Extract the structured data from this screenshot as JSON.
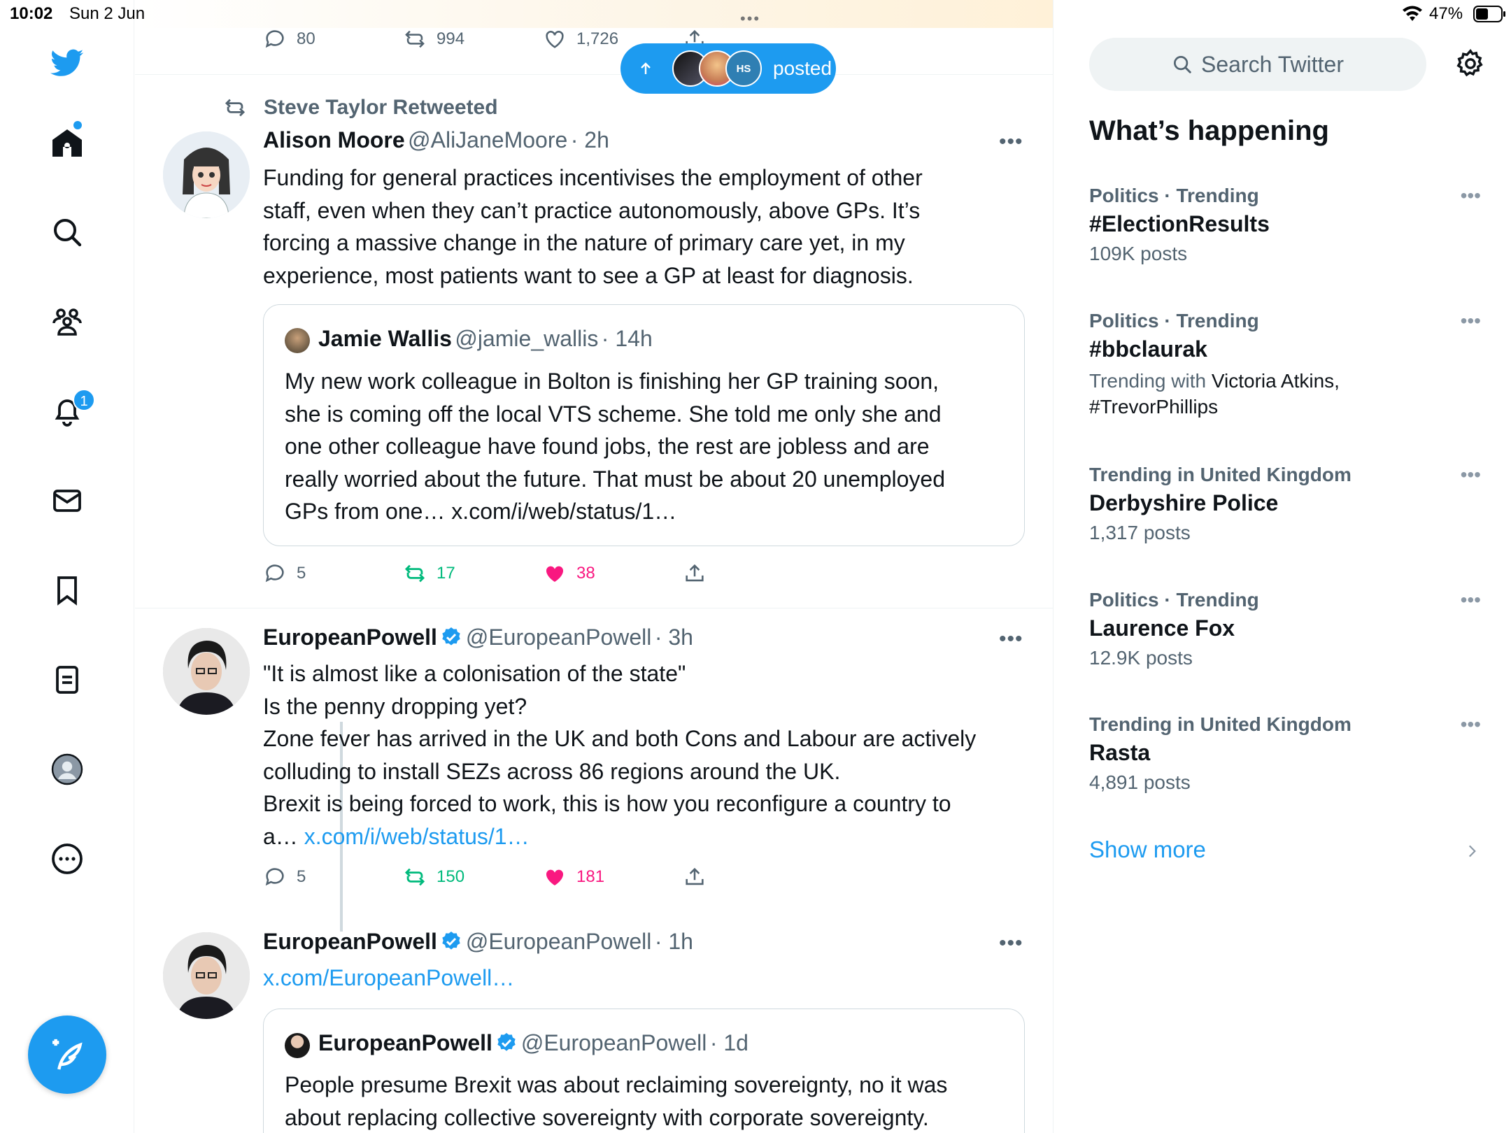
{
  "status_bar": {
    "time": "10:02",
    "date": "Sun 2 Jun",
    "battery": "47%"
  },
  "nav": {
    "notifications_badge": "1"
  },
  "top_counts": {
    "replies": "80",
    "retweets": "994",
    "likes": "1,726"
  },
  "posted_pill": {
    "label": "posted",
    "avatar_text": "HS"
  },
  "tweet1": {
    "retweeted_by": "Steve Taylor Retweeted",
    "name": "Alison Moore",
    "handle": "@AliJaneMoore",
    "time": "· 2h",
    "text": "Funding for general practices incentivises the employment of other\nstaff, even when they can’t practice autonomously, above GPs. It’s\nforcing a massive change in the nature of primary care yet, in my\nexperience, most patients want to see a GP at least for diagnosis.",
    "quote": {
      "name": "Jamie Wallis",
      "handle": "@jamie_wallis",
      "time": "· 14h",
      "text": "My new work colleague in Bolton is finishing her GP training soon,\nshe is coming off the local VTS scheme. She told me only she and\none other colleague have found jobs, the rest are jobless and are\nreally worried about the future. That must be about 20 unemployed\nGPs from one… x.com/i/web/status/1…"
    },
    "replies": "5",
    "retweets": "17",
    "likes": "38"
  },
  "tweet2": {
    "name": "EuropeanPowell",
    "handle": "@EuropeanPowell",
    "time": "· 3h",
    "text": "\"It is almost like a colonisation of the state\"\nIs the penny dropping yet?\nZone fever has arrived in the UK and both Cons and Labour are actively\ncolluding to install SEZs across 86 regions around the UK.\nBrexit is being forced to work, this is how you reconfigure a country to",
    "text_tail": "a… ",
    "link": "x.com/i/web/status/1…",
    "replies": "5",
    "retweets": "150",
    "likes": "181"
  },
  "tweet3": {
    "name": "EuropeanPowell",
    "handle": "@EuropeanPowell",
    "time": "· 1h",
    "link": "x.com/EuropeanPowell…",
    "quote": {
      "name": "EuropeanPowell",
      "handle": "@EuropeanPowell",
      "time": "· 1d",
      "text": "People presume Brexit was about reclaiming sovereignty, no it was\nabout replacing collective sovereignty with corporate sovereignty."
    }
  },
  "sidebar": {
    "search_placeholder": "Search Twitter",
    "heading": "What’s happening",
    "trends": [
      {
        "category": "Politics · Trending",
        "name": "#ElectionResults",
        "count": "109K posts"
      },
      {
        "category": "Politics · Trending",
        "name": "#bbclaurak",
        "count_prefix": "Trending with ",
        "count_names": "Victoria Atkins,",
        "count_line2": "#TrevorPhillips"
      },
      {
        "category": "Trending in United Kingdom",
        "name": "Derbyshire Police",
        "count": "1,317 posts"
      },
      {
        "category": "Politics · Trending",
        "name": "Laurence Fox",
        "count": "12.9K posts"
      },
      {
        "category": "Trending in United Kingdom",
        "name": "Rasta",
        "count": "4,891 posts"
      }
    ],
    "show_more": "Show more"
  },
  "colors": {
    "accent": "#1d9bf0",
    "retweet": "#00ba7c",
    "like": "#f91880",
    "muted": "#536471"
  }
}
